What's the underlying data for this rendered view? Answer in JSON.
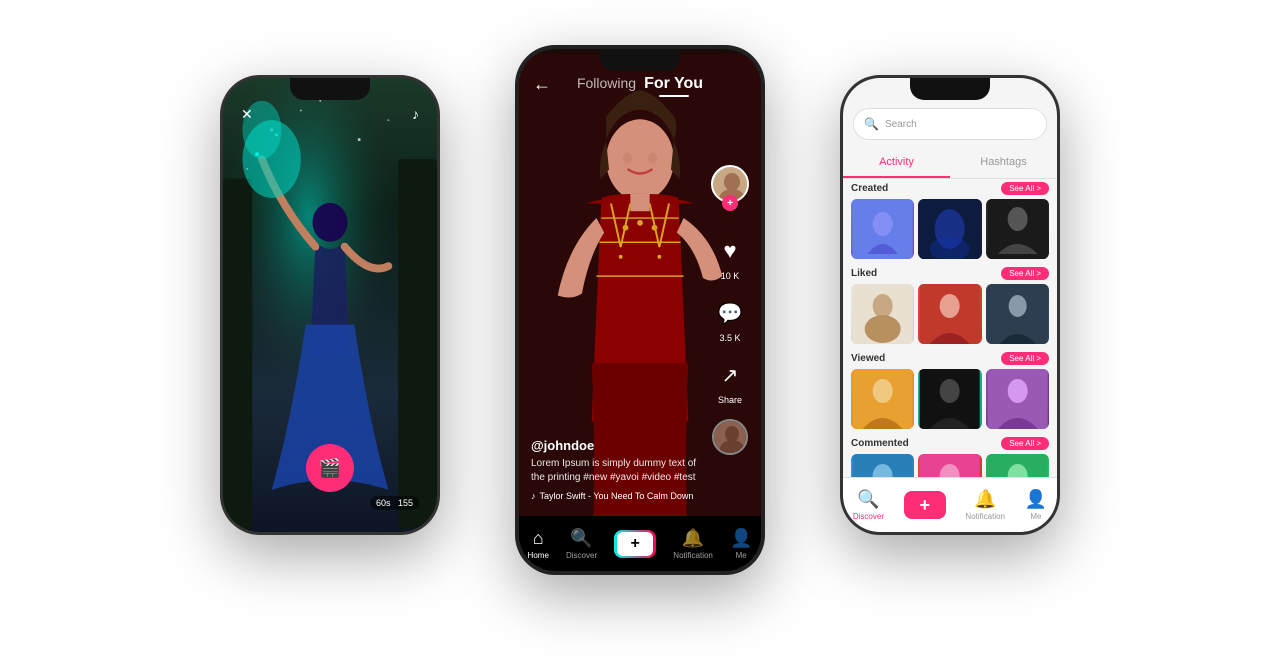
{
  "left_phone": {
    "top_left_icon": "✕",
    "top_right_icon": "♪",
    "record_btn": "🎬",
    "timer": "60s",
    "timer_badge": "155"
  },
  "center_phone": {
    "back_arrow": "←",
    "following_tab": "Following",
    "foryou_tab": "For You",
    "username": "@johndoe",
    "caption": "Lorem Ipsum is simply dummy text of the printing #new #yavoi #video #test",
    "music_note": "♪",
    "music_text": "Taylor Swift - You Need To Calm Down",
    "likes_count": "10 K",
    "comments_count": "3.5 K",
    "share_label": "Share",
    "nav": {
      "home": "Home",
      "discover": "Discover",
      "plus": "+",
      "notification": "Notification",
      "me": "Me"
    }
  },
  "right_phone": {
    "search_placeholder": "Search",
    "tab_activity": "Activity",
    "tab_hashtags": "Hashtags",
    "sections": [
      {
        "title": "Created",
        "see_all": "See All >"
      },
      {
        "title": "Liked",
        "see_all": "See All >"
      },
      {
        "title": "Viewed",
        "see_all": "See All >"
      },
      {
        "title": "Commented",
        "see_all": "See All >"
      }
    ],
    "nav": {
      "discover": "Discover",
      "plus": "+",
      "notification": "Notification",
      "me": "Me"
    }
  },
  "colors": {
    "accent": "#ff2d78",
    "dark": "#111111",
    "light_bg": "#f5f5f5"
  }
}
